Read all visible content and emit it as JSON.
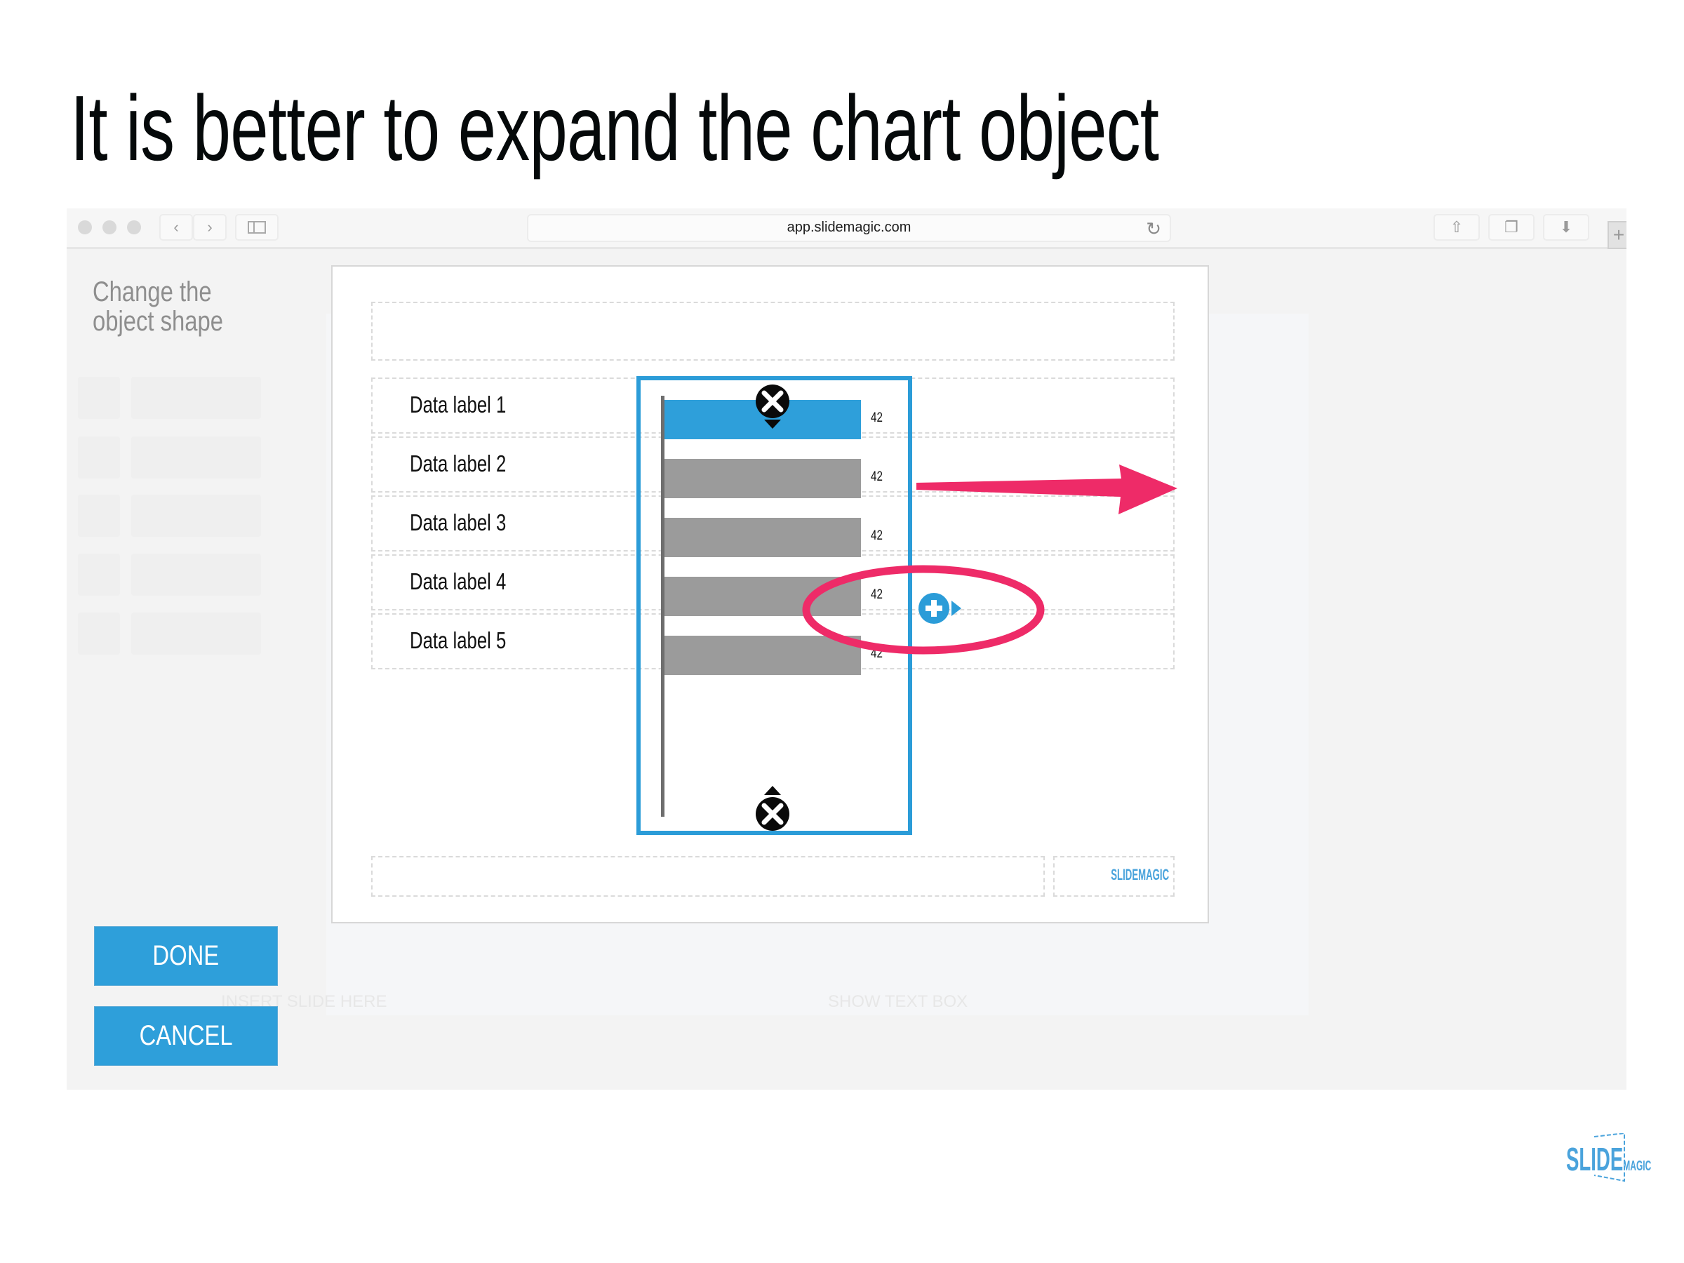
{
  "slide_title": "It is better to expand the chart object",
  "browser": {
    "url": "app.slidemagic.com",
    "icons": {
      "back": "chevron-left-icon",
      "forward": "chevron-right-icon",
      "sidebar": "sidebar-icon",
      "reload": "reload-icon",
      "share": "share-icon",
      "tabs": "tabs-icon",
      "download": "download-icon",
      "new_tab": "plus-icon"
    },
    "glyphs": {
      "back": "‹",
      "forward": "›",
      "reload": "↻",
      "share": "⇧",
      "tabs": "❐",
      "download": "⬇",
      "new_tab": "+"
    }
  },
  "sidebar": {
    "heading": "Change the object shape",
    "buttons": {
      "done": "DONE",
      "cancel": "CANCEL"
    }
  },
  "editor": {
    "chart": {
      "rows": [
        {
          "label": "Data label 1",
          "value": "42",
          "highlighted": true
        },
        {
          "label": "Data label 2",
          "value": "42",
          "highlighted": false
        },
        {
          "label": "Data label 3",
          "value": "42",
          "highlighted": false
        },
        {
          "label": "Data label 4",
          "value": "42",
          "highlighted": false
        },
        {
          "label": "Data label 5",
          "value": "42",
          "highlighted": false
        }
      ],
      "colors": {
        "highlight_bar": "#2e9fda",
        "bar": "#9b9b9b",
        "selection": "#2b9cd8",
        "annotation": "#ee2b68"
      }
    },
    "slide_logo": "SLIDEMAGIC"
  },
  "background_ghost": {
    "insert_text": "INSERT SLIDE HERE",
    "show_text_box": "SHOW TEXT BOX"
  },
  "footer_logo": {
    "big": "SLIDE",
    "small": "MAGIC",
    "color": "#4aa3dc"
  }
}
